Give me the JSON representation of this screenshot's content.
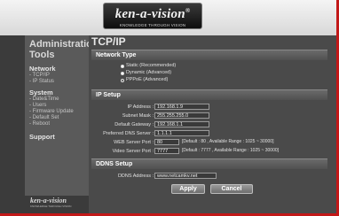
{
  "header": {
    "logo_text": "ken-a-vision",
    "logo_mark": "®",
    "logo_tagline": "KNOWLEDGE THROUGH VISION"
  },
  "sidebar": {
    "title_line1": "Administration",
    "title_line2": "Tools",
    "sections": [
      {
        "label": "Network",
        "items": [
          "- TCP/IP",
          "- IP Status"
        ]
      },
      {
        "label": "System",
        "items": [
          "- Date&Time",
          "- Users",
          "- Firmware Update",
          "- Default Set",
          "- Reboot"
        ]
      },
      {
        "label": "Support",
        "items": []
      }
    ],
    "footer_logo": "ken-a-vision",
    "footer_tagline": "KNOWLEDGE THROUGH VISION"
  },
  "main": {
    "title": "TCP/IP",
    "network_type": {
      "heading": "Network Type",
      "options": [
        "Static (Recommended)",
        "Dynamic (Advanced)",
        "PPPoE (Advanced)"
      ],
      "selected_index": 0
    },
    "ip_setup": {
      "heading": "IP Setup",
      "fields": [
        {
          "label": "IP Address :",
          "value": "192.168.1.9"
        },
        {
          "label": "Subnet Mask :",
          "value": "255.255.255.0"
        },
        {
          "label": "Default Gateway :",
          "value": "192.168.1.1"
        },
        {
          "label": "Preferred DNS Server :",
          "value": "1.1.1.1"
        },
        {
          "label": "WEB Server Port :",
          "value": "80",
          "hint": "[Default : 80 , Available Range : 1025 ~ 30000]"
        },
        {
          "label": "Video Server Port :",
          "value": "7777",
          "hint": "[Default : 7777 , Available Range : 1025 ~ 30000]"
        }
      ]
    },
    "ddns_setup": {
      "heading": "DDNS Setup",
      "label": "DDNS Address :",
      "value": "www.netcamkv.net"
    },
    "apply_label": "Apply",
    "cancel_label": "Cancel"
  },
  "colors": {
    "accent_red": "#c21818",
    "panel_bg": "#4a4a4a",
    "sidebar_bg": "#3b3b3b"
  }
}
